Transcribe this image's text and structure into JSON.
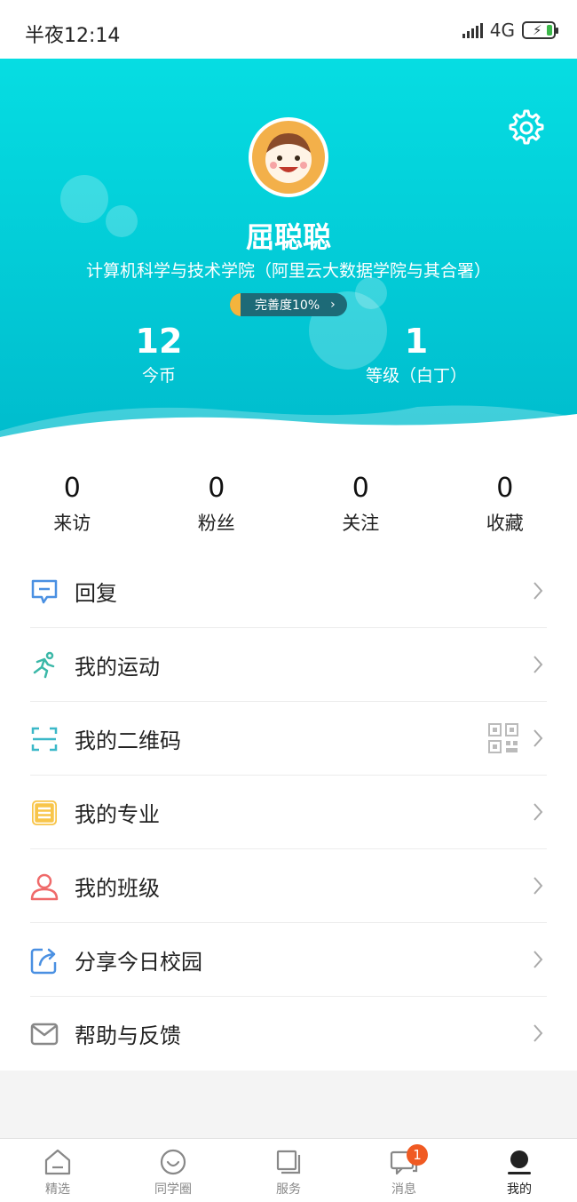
{
  "status_bar": {
    "time": "半夜12:14",
    "network": "4G"
  },
  "profile": {
    "name": "屈聪聪",
    "college": "计算机科学与技术学院（阿里云大数据学院与其合署）",
    "completion_label": "完善度10%",
    "completion_percent": 10,
    "coins": {
      "value": "12",
      "label": "今币"
    },
    "level": {
      "value": "1",
      "label": "等级（白丁）"
    }
  },
  "counters": [
    {
      "value": "0",
      "label": "来访"
    },
    {
      "value": "0",
      "label": "粉丝"
    },
    {
      "value": "0",
      "label": "关注"
    },
    {
      "value": "0",
      "label": "收藏"
    }
  ],
  "menu": [
    {
      "label": "回复",
      "icon": "reply-icon"
    },
    {
      "label": "我的运动",
      "icon": "running-icon"
    },
    {
      "label": "我的二维码",
      "icon": "scan-icon"
    },
    {
      "label": "我的专业",
      "icon": "list-icon"
    },
    {
      "label": "我的班级",
      "icon": "person-icon"
    },
    {
      "label": "分享今日校园",
      "icon": "share-icon"
    },
    {
      "label": "帮助与反馈",
      "icon": "mail-icon"
    }
  ],
  "tabs": [
    {
      "label": "精选",
      "icon": "home-icon"
    },
    {
      "label": "同学圈",
      "icon": "smile-icon"
    },
    {
      "label": "服务",
      "icon": "services-icon"
    },
    {
      "label": "消息",
      "icon": "chat-icon",
      "badge": "1"
    },
    {
      "label": "我的",
      "icon": "profile-icon",
      "active": true
    }
  ],
  "colors": {
    "header_top": "#06dde2",
    "header_bottom": "#00bccd",
    "badge": "#f05a22",
    "completion_bar": "#f4b43d"
  }
}
